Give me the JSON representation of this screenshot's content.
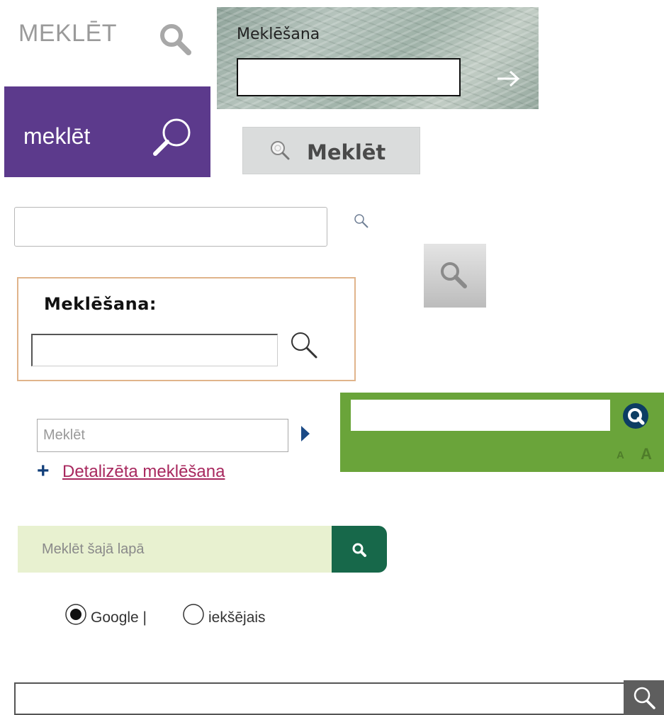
{
  "widget_meklet_gray": {
    "label": "MEKLĒT",
    "icon": "search-icon"
  },
  "widget_textured": {
    "label": "Meklēšana",
    "input_value": "",
    "icon": "arrow-right-icon"
  },
  "widget_purple": {
    "label": "meklēt",
    "icon": "search-icon",
    "bg_color": "#5c3a8c"
  },
  "widget_gray_button": {
    "label": "Meklēt",
    "icon": "search-icon"
  },
  "widget_plain": {
    "input_value": "",
    "icon": "search-icon"
  },
  "widget_gray_square": {
    "icon": "search-icon"
  },
  "widget_bordered": {
    "label": "Meklēšana:",
    "input_value": "",
    "icon": "search-icon",
    "border_color": "#e0b48b"
  },
  "widget_detailed": {
    "placeholder": "Meklēt",
    "arrow_icon": "triangle-right-icon",
    "plus": "+",
    "link": "Detalizēta meklēšana",
    "link_color": "#a8285e"
  },
  "widget_green": {
    "input_value": "",
    "icon": "search-icon",
    "font_small": "A",
    "font_large": "A",
    "bg_color": "#6aa43a"
  },
  "widget_page_search": {
    "placeholder": "Meklēt šajā lapā",
    "icon": "search-icon",
    "bg_color": "#e8f1d0",
    "button_color": "#17684a"
  },
  "widget_radio": {
    "options": [
      {
        "label": "Google |",
        "checked": true
      },
      {
        "label": "iekšējais",
        "checked": false
      }
    ]
  },
  "widget_bottom_bar": {
    "input_value": "",
    "icon": "search-icon"
  }
}
